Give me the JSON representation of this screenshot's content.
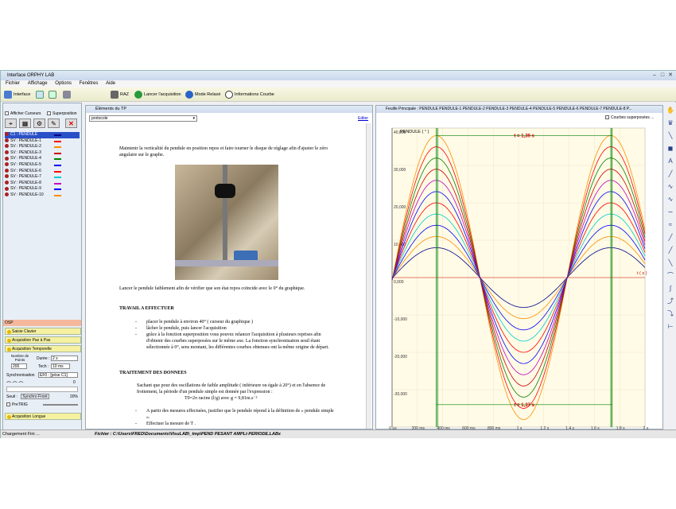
{
  "window": {
    "title": "Interface ORPHY LAB",
    "ctl_min": "–",
    "ctl_max": "□",
    "ctl_close": "✕"
  },
  "menu": [
    "Fichier",
    "Affichage",
    "Options",
    "Fenêtres",
    "Aide"
  ],
  "toolbar": {
    "interface": "Interface",
    "raz": "RAZ",
    "lancer": "Lancer l'acquisition",
    "mode": "Mode Relaxé",
    "infos": "Informations Courbe"
  },
  "left": {
    "afficher_curseurs": "Afficher Curseurs",
    "superposition": "Superposition",
    "curves": [
      {
        "label": "C1 : PENDULE",
        "color": "#00008b"
      },
      {
        "label": "SV : PENDULE-1",
        "color": "#ff0000"
      },
      {
        "label": "SV : PENDULE-2",
        "color": "#ff8c00"
      },
      {
        "label": "SV : PENDULE-3",
        "color": "#cc0000"
      },
      {
        "label": "SV : PENDULE-4",
        "color": "#008000"
      },
      {
        "label": "SV : PENDULE-5",
        "color": "#0000ff"
      },
      {
        "label": "SV : PENDULE-6",
        "color": "#ff0000"
      },
      {
        "label": "SV : PENDULE-7",
        "color": "#00cccc"
      },
      {
        "label": "SV : PENDULE-8",
        "color": "#c000c0"
      },
      {
        "label": "SV : PENDULE-9",
        "color": "#0000ff"
      },
      {
        "label": "SV : PENDULE-10",
        "color": "#ff8c00"
      }
    ],
    "osp": "OSP",
    "sections": [
      "Saisie Clavier",
      "Acquisition Pas à Pas",
      "Acquisition Temporelle"
    ],
    "nombre_points_label": "Nombre de Points",
    "nombre_points": "200",
    "duree_label": "Durée :",
    "duree": "2 s",
    "tech_label": "Tech :",
    "tech": "10 ms",
    "sync_label": "Synchronisation",
    "sync_value": "EF0 : [prise C1]",
    "seuil_label": "Seuil :",
    "front": "Synchro Front",
    "zero": "0",
    "pct": "20%",
    "pretrig": "PreTRIG",
    "acq_longue": "Acquisition Longue"
  },
  "doc": {
    "title": "Éléments du TP",
    "dropdown": "protocole",
    "editer": "Editer",
    "p1": "Maintenir la verticalité du pendule en position repos et faire tourner le disque de réglage afin d'ajuster le zéro angulaire sur le graphe.",
    "p2": "Lancer le pendule faiblement afin de vérifier que son état repos coïncide avec le 0° du graphique.",
    "h1": "TRAVAIL A EFFECTUER",
    "b1": "placer le pendule à environ 40° ( curseur du graphique )",
    "b2": "lâcher le pendule, puis lancer l'acquisition",
    "b3": "grâce à la fonction superposition vous pouvez relancer l'acquisition à plusieurs reprises afin d'obtenir des courbes superposées sur le même axe. La fonction synchronisation seuil étant sélectionnée à 0°, sens montant, les différentes courbes obtenues ont la même origine de départ.",
    "h2": "TRAITEMENT DES DONNEES",
    "p3": "Sachant que pour des oscillations de faible amplitude ( inférieure ou égale à 20°) et en l'absence de frottement, la période d'un pendule simple est donnée par l'expression :",
    "formula": "T0=2π racine (l/g)  avec g = 9,81m.s⁻²",
    "p4": "A partir des mesures effectuées, justifier que le pendule répond à la définition de « pendule simple ».",
    "p5": "Effectuer la mesure de T ."
  },
  "chart_panel": {
    "title": "Feuille Principale : PENDULE PENDULE-1 PENDULE-2 PENDULE-3 PENDULE-4 PENDULE-5 PENDULE-6 PENDULE-7 PENDULE-8 P...",
    "courbes_sup": "Courbes superposées ..."
  },
  "chart_data": {
    "type": "line",
    "ylabel": "PENDULE ( ° )",
    "xlabel": "t ( s )",
    "ylim": [
      -40,
      40
    ],
    "xlim": [
      0,
      2
    ],
    "yticks": [
      {
        "v": 40,
        "l": "40,000"
      },
      {
        "v": 30,
        "l": "30,000"
      },
      {
        "v": 20,
        "l": "20,000"
      },
      {
        "v": 10,
        "l": "10,000"
      },
      {
        "v": 0,
        "l": "0,000"
      },
      {
        "v": -10,
        "l": "-10,000"
      },
      {
        "v": -20,
        "l": "-20,000"
      },
      {
        "v": -30,
        "l": "-30,000"
      },
      {
        "v": -40,
        "l": "-40,000"
      }
    ],
    "xticks": [
      {
        "v": 0,
        "l": "0 µs"
      },
      {
        "v": 0.2,
        "l": "200 ms"
      },
      {
        "v": 0.4,
        "l": "400 ms"
      },
      {
        "v": 0.6,
        "l": "600 ms"
      },
      {
        "v": 0.8,
        "l": "800 ms"
      },
      {
        "v": 1.0,
        "l": "1 s"
      },
      {
        "v": 1.2,
        "l": "1,2 s"
      },
      {
        "v": 1.4,
        "l": "1,4 s"
      },
      {
        "v": 1.6,
        "l": "1,6 s"
      },
      {
        "v": 1.8,
        "l": "1,8 s"
      },
      {
        "v": 2.0,
        "l": "2 s"
      }
    ],
    "period_s": 1.38,
    "series": [
      {
        "amplitude": 38,
        "color": "#ff8c00"
      },
      {
        "amplitude": 35,
        "color": "#ff0000"
      },
      {
        "amplitude": 32,
        "color": "#008000"
      },
      {
        "amplitude": 29,
        "color": "#cc0000"
      },
      {
        "amplitude": 26,
        "color": "#c000c0"
      },
      {
        "amplitude": 23,
        "color": "#0000ff"
      },
      {
        "amplitude": 20,
        "color": "#ff0000"
      },
      {
        "amplitude": 17,
        "color": "#00cccc"
      },
      {
        "amplitude": 14,
        "color": "#0000ff"
      },
      {
        "amplitude": 11,
        "color": "#ff8c00"
      },
      {
        "amplitude": 8,
        "color": "#00008b"
      }
    ],
    "cursors": [
      0.35,
      1.74,
      0.36,
      1.73
    ],
    "annotations": [
      {
        "text": "t = 1,39 s",
        "y": 38
      },
      {
        "text": "t = 1,37 s",
        "y": -34
      }
    ]
  },
  "status": {
    "left": "Chargement Fini ...",
    "file": "Fichier : C:\\Users\\FRED\\Documents\\VisuLAB\\_tmp\\PEND PESANT AMPLI-PERIODE.LABx"
  }
}
